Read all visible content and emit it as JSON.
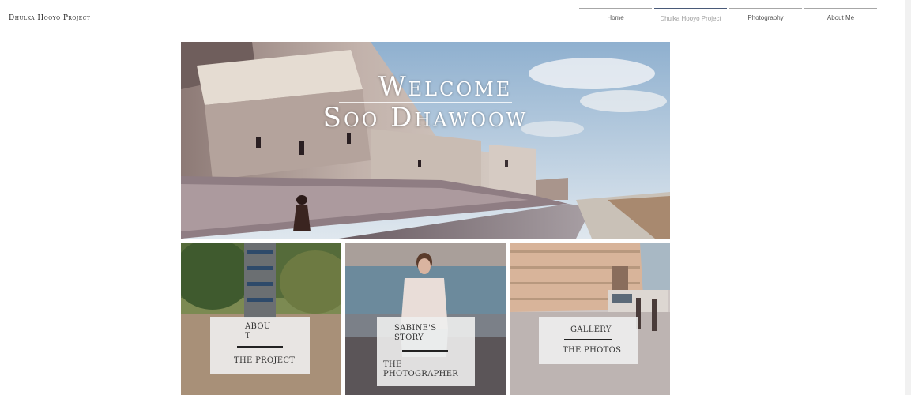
{
  "site": {
    "title": "Dhulka Hooyo Project"
  },
  "nav": {
    "items": [
      {
        "label": "Home",
        "active": false
      },
      {
        "label": "Dhulka Hooyo Project",
        "active": true
      },
      {
        "label": "Photography",
        "active": false
      },
      {
        "label": "About Me",
        "active": false
      }
    ]
  },
  "hero": {
    "line1": "Welcome",
    "line2": "Soo Dhawoow"
  },
  "tiles": [
    {
      "top_label_line1": "Abou",
      "top_label_line2": "t",
      "bottom_label": "The Project"
    },
    {
      "top_label_line1": "Sabine's",
      "top_label_line2": "Story",
      "bottom_label_line1": "The",
      "bottom_label_line2": "photographer"
    },
    {
      "top_label": "Gallery",
      "bottom_label": "The photos"
    }
  ],
  "colors": {
    "nav_active_border": "#4a5a78",
    "card_background": "#eeeeee"
  }
}
